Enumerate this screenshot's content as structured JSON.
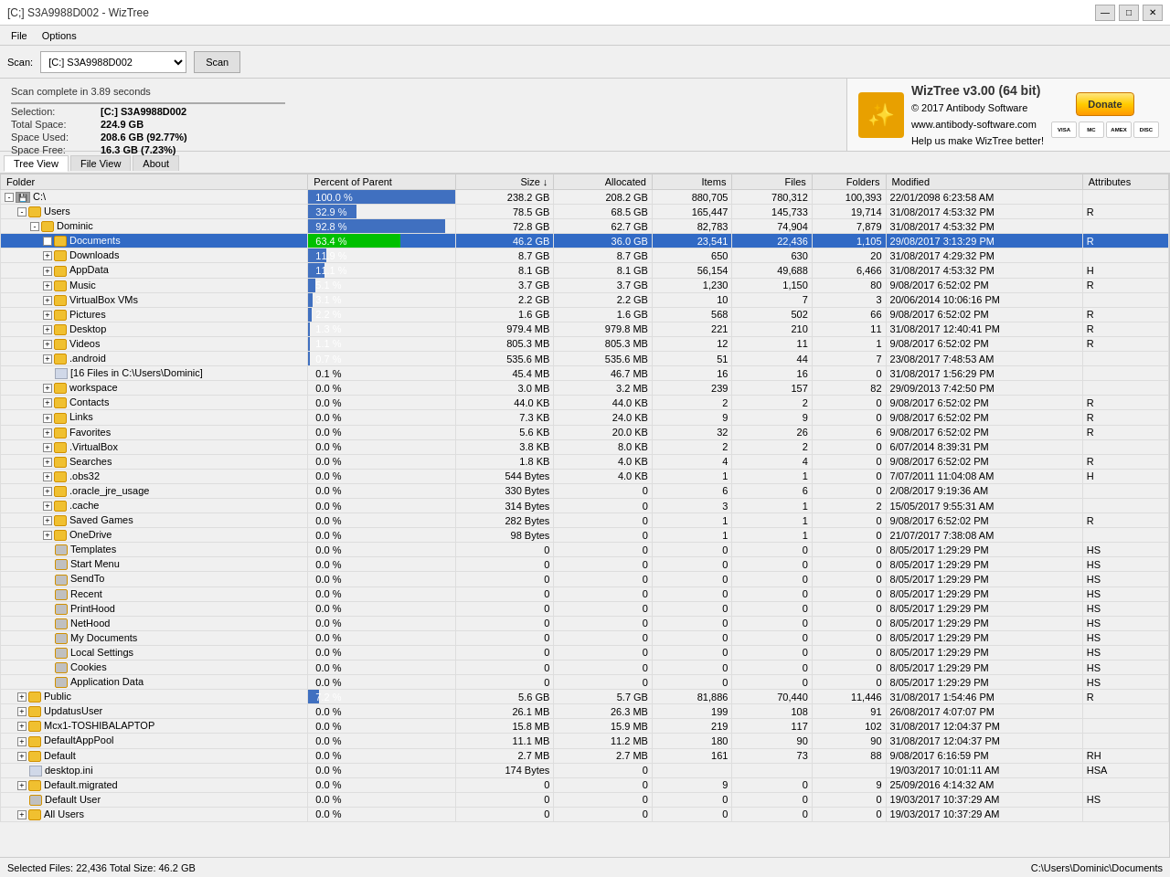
{
  "titleBar": {
    "title": "[C;] S3A9988D002  - WizTree"
  },
  "menuBar": {
    "items": [
      "File",
      "Options"
    ]
  },
  "toolbar": {
    "scanLabel": "Scan:",
    "driveValue": "[C:] S3A9988D002",
    "scanButton": "Scan"
  },
  "infoPanel": {
    "scanTime": "Scan complete in 3.89 seconds",
    "selectionLabel": "Selection:",
    "selectionValue": "[C:]  S3A9988D002",
    "totalSpaceLabel": "Total Space:",
    "totalSpaceValue": "224.9 GB",
    "spaceUsedLabel": "Space Used:",
    "spaceUsedValue": "208.6 GB  (92.77%)",
    "spaceFreeLabel": "Space Free:",
    "spaceFreeValue": "16.3 GB  (7.23%)"
  },
  "branding": {
    "title": "WizTree v3.00 (64 bit)",
    "line2": "© 2017 Antibody Software",
    "line3": "www.antibody-software.com",
    "donateBtn": "Donate",
    "helpText": "Help us make WizTree better!"
  },
  "tabs": {
    "treeView": "Tree View",
    "fileView": "File View",
    "about": "About"
  },
  "tableHeaders": {
    "folder": "Folder",
    "percentOfParent": "Percent of Parent",
    "size": "Size ↓",
    "allocated": "Allocated",
    "items": "Items",
    "files": "Files",
    "folders": "Folders",
    "modified": "Modified",
    "attributes": "Attributes"
  },
  "rows": [
    {
      "indent": 0,
      "toggle": "-",
      "icon": "drive",
      "name": "C:\\",
      "pct": 100.0,
      "pctBar": 100,
      "barGreen": false,
      "size": "238.2 GB",
      "alloc": "208.2 GB",
      "items": "880,705",
      "files": "780,312",
      "folders": "100,393",
      "modified": "22/01/2098 6:23:58 AM",
      "attr": ""
    },
    {
      "indent": 1,
      "toggle": "-",
      "icon": "folder",
      "name": "Users",
      "pct": 32.9,
      "pctBar": 33,
      "barGreen": false,
      "size": "78.5 GB",
      "alloc": "68.5 GB",
      "items": "165,447",
      "files": "145,733",
      "folders": "19,714",
      "modified": "31/08/2017 4:53:32 PM",
      "attr": "R"
    },
    {
      "indent": 2,
      "toggle": "-",
      "icon": "folder",
      "name": "Dominic",
      "pct": 92.8,
      "pctBar": 93,
      "barGreen": false,
      "size": "72.8 GB",
      "alloc": "62.7 GB",
      "items": "82,783",
      "files": "74,904",
      "folders": "7,879",
      "modified": "31/08/2017 4:53:32 PM",
      "attr": ""
    },
    {
      "indent": 3,
      "toggle": "+",
      "icon": "folder",
      "name": "Documents",
      "pct": 63.4,
      "pctBar": 63,
      "barGreen": true,
      "size": "46.2 GB",
      "alloc": "36.0 GB",
      "items": "23,541",
      "files": "22,436",
      "folders": "1,105",
      "modified": "29/08/2017 3:13:29 PM",
      "attr": "R",
      "selected": true
    },
    {
      "indent": 3,
      "toggle": "+",
      "icon": "folder",
      "name": "Downloads",
      "pct": 11.9,
      "pctBar": 12,
      "barGreen": false,
      "size": "8.7 GB",
      "alloc": "8.7 GB",
      "items": "650",
      "files": "630",
      "folders": "20",
      "modified": "31/08/2017 4:29:32 PM",
      "attr": ""
    },
    {
      "indent": 3,
      "toggle": "+",
      "icon": "folder",
      "name": "AppData",
      "pct": 11.1,
      "pctBar": 11,
      "barGreen": false,
      "size": "8.1 GB",
      "alloc": "8.1 GB",
      "items": "56,154",
      "files": "49,688",
      "folders": "6,466",
      "modified": "31/08/2017 4:53:32 PM",
      "attr": "H"
    },
    {
      "indent": 3,
      "toggle": "+",
      "icon": "folder",
      "name": "Music",
      "pct": 5.1,
      "pctBar": 5,
      "barGreen": false,
      "size": "3.7 GB",
      "alloc": "3.7 GB",
      "items": "1,230",
      "files": "1,150",
      "folders": "80",
      "modified": "9/08/2017 6:52:02 PM",
      "attr": "R"
    },
    {
      "indent": 3,
      "toggle": "+",
      "icon": "folder",
      "name": "VirtualBox VMs",
      "pct": 3.1,
      "pctBar": 3,
      "barGreen": false,
      "size": "2.2 GB",
      "alloc": "2.2 GB",
      "items": "10",
      "files": "7",
      "folders": "3",
      "modified": "20/06/2014 10:06:16 PM",
      "attr": ""
    },
    {
      "indent": 3,
      "toggle": "+",
      "icon": "folder",
      "name": "Pictures",
      "pct": 2.2,
      "pctBar": 2,
      "barGreen": false,
      "size": "1.6 GB",
      "alloc": "1.6 GB",
      "items": "568",
      "files": "502",
      "folders": "66",
      "modified": "9/08/2017 6:52:02 PM",
      "attr": "R"
    },
    {
      "indent": 3,
      "toggle": "+",
      "icon": "folder",
      "name": "Desktop",
      "pct": 1.3,
      "pctBar": 1,
      "barGreen": false,
      "size": "979.4 MB",
      "alloc": "979.8 MB",
      "items": "221",
      "files": "210",
      "folders": "11",
      "modified": "31/08/2017 12:40:41 PM",
      "attr": "R"
    },
    {
      "indent": 3,
      "toggle": "+",
      "icon": "folder",
      "name": "Videos",
      "pct": 1.1,
      "pctBar": 1,
      "barGreen": false,
      "size": "805.3 MB",
      "alloc": "805.3 MB",
      "items": "12",
      "files": "11",
      "folders": "1",
      "modified": "9/08/2017 6:52:02 PM",
      "attr": "R"
    },
    {
      "indent": 3,
      "toggle": "+",
      "icon": "folder",
      "name": ".android",
      "pct": 0.7,
      "pctBar": 1,
      "barGreen": false,
      "size": "535.6 MB",
      "alloc": "535.6 MB",
      "items": "51",
      "files": "44",
      "folders": "7",
      "modified": "23/08/2017 7:48:53 AM",
      "attr": ""
    },
    {
      "indent": 3,
      "toggle": " ",
      "icon": "file",
      "name": "[16 Files in C:\\Users\\Dominic]",
      "pct": 0.1,
      "pctBar": 0,
      "barGreen": false,
      "size": "45.4 MB",
      "alloc": "46.7 MB",
      "items": "16",
      "files": "16",
      "folders": "0",
      "modified": "31/08/2017 1:56:29 PM",
      "attr": ""
    },
    {
      "indent": 3,
      "toggle": "+",
      "icon": "folder",
      "name": "workspace",
      "pct": 0.0,
      "pctBar": 0,
      "barGreen": false,
      "size": "3.0 MB",
      "alloc": "3.2 MB",
      "items": "239",
      "files": "157",
      "folders": "82",
      "modified": "29/09/2013 7:42:50 PM",
      "attr": ""
    },
    {
      "indent": 3,
      "toggle": "+",
      "icon": "folder",
      "name": "Contacts",
      "pct": 0.0,
      "pctBar": 0,
      "barGreen": false,
      "size": "44.0 KB",
      "alloc": "44.0 KB",
      "items": "2",
      "files": "2",
      "folders": "0",
      "modified": "9/08/2017 6:52:02 PM",
      "attr": "R"
    },
    {
      "indent": 3,
      "toggle": "+",
      "icon": "folder",
      "name": "Links",
      "pct": 0.0,
      "pctBar": 0,
      "barGreen": false,
      "size": "7.3 KB",
      "alloc": "24.0 KB",
      "items": "9",
      "files": "9",
      "folders": "0",
      "modified": "9/08/2017 6:52:02 PM",
      "attr": "R"
    },
    {
      "indent": 3,
      "toggle": "+",
      "icon": "folder",
      "name": "Favorites",
      "pct": 0.0,
      "pctBar": 0,
      "barGreen": false,
      "size": "5.6 KB",
      "alloc": "20.0 KB",
      "items": "32",
      "files": "26",
      "folders": "6",
      "modified": "9/08/2017 6:52:02 PM",
      "attr": "R"
    },
    {
      "indent": 3,
      "toggle": "+",
      "icon": "folder",
      "name": ".VirtualBox",
      "pct": 0.0,
      "pctBar": 0,
      "barGreen": false,
      "size": "3.8 KB",
      "alloc": "8.0 KB",
      "items": "2",
      "files": "2",
      "folders": "0",
      "modified": "6/07/2014 8:39:31 PM",
      "attr": ""
    },
    {
      "indent": 3,
      "toggle": "+",
      "icon": "folder",
      "name": "Searches",
      "pct": 0.0,
      "pctBar": 0,
      "barGreen": false,
      "size": "1.8 KB",
      "alloc": "4.0 KB",
      "items": "4",
      "files": "4",
      "folders": "0",
      "modified": "9/08/2017 6:52:02 PM",
      "attr": "R"
    },
    {
      "indent": 3,
      "toggle": "+",
      "icon": "folder",
      "name": ".obs32",
      "pct": 0.0,
      "pctBar": 0,
      "barGreen": false,
      "size": "544 Bytes",
      "alloc": "4.0 KB",
      "items": "1",
      "files": "1",
      "folders": "0",
      "modified": "7/07/2011 11:04:08 AM",
      "attr": "H"
    },
    {
      "indent": 3,
      "toggle": "+",
      "icon": "folder",
      "name": ".oracle_jre_usage",
      "pct": 0.0,
      "pctBar": 0,
      "barGreen": false,
      "size": "330 Bytes",
      "alloc": "0",
      "items": "6",
      "files": "6",
      "folders": "0",
      "modified": "2/08/2017 9:19:36 AM",
      "attr": ""
    },
    {
      "indent": 3,
      "toggle": "+",
      "icon": "folder",
      "name": ".cache",
      "pct": 0.0,
      "pctBar": 0,
      "barGreen": false,
      "size": "314 Bytes",
      "alloc": "0",
      "items": "3",
      "files": "1",
      "folders": "2",
      "modified": "15/05/2017 9:55:31 AM",
      "attr": ""
    },
    {
      "indent": 3,
      "toggle": "+",
      "icon": "folder",
      "name": "Saved Games",
      "pct": 0.0,
      "pctBar": 0,
      "barGreen": false,
      "size": "282 Bytes",
      "alloc": "0",
      "items": "1",
      "files": "1",
      "folders": "0",
      "modified": "9/08/2017 6:52:02 PM",
      "attr": "R"
    },
    {
      "indent": 3,
      "toggle": "+",
      "icon": "folder",
      "name": "OneDrive",
      "pct": 0.0,
      "pctBar": 0,
      "barGreen": false,
      "size": "98 Bytes",
      "alloc": "0",
      "items": "1",
      "files": "1",
      "folders": "0",
      "modified": "21/07/2017 7:38:08 AM",
      "attr": ""
    },
    {
      "indent": 3,
      "toggle": " ",
      "icon": "gear",
      "name": "Templates",
      "pct": 0.0,
      "pctBar": 0,
      "barGreen": false,
      "size": "0",
      "alloc": "0",
      "items": "0",
      "files": "0",
      "folders": "0",
      "modified": "8/05/2017 1:29:29 PM",
      "attr": "HS"
    },
    {
      "indent": 3,
      "toggle": " ",
      "icon": "gear",
      "name": "Start Menu",
      "pct": 0.0,
      "pctBar": 0,
      "barGreen": false,
      "size": "0",
      "alloc": "0",
      "items": "0",
      "files": "0",
      "folders": "0",
      "modified": "8/05/2017 1:29:29 PM",
      "attr": "HS"
    },
    {
      "indent": 3,
      "toggle": " ",
      "icon": "gear",
      "name": "SendTo",
      "pct": 0.0,
      "pctBar": 0,
      "barGreen": false,
      "size": "0",
      "alloc": "0",
      "items": "0",
      "files": "0",
      "folders": "0",
      "modified": "8/05/2017 1:29:29 PM",
      "attr": "HS"
    },
    {
      "indent": 3,
      "toggle": " ",
      "icon": "gear",
      "name": "Recent",
      "pct": 0.0,
      "pctBar": 0,
      "barGreen": false,
      "size": "0",
      "alloc": "0",
      "items": "0",
      "files": "0",
      "folders": "0",
      "modified": "8/05/2017 1:29:29 PM",
      "attr": "HS"
    },
    {
      "indent": 3,
      "toggle": " ",
      "icon": "gear",
      "name": "PrintHood",
      "pct": 0.0,
      "pctBar": 0,
      "barGreen": false,
      "size": "0",
      "alloc": "0",
      "items": "0",
      "files": "0",
      "folders": "0",
      "modified": "8/05/2017 1:29:29 PM",
      "attr": "HS"
    },
    {
      "indent": 3,
      "toggle": " ",
      "icon": "gear",
      "name": "NetHood",
      "pct": 0.0,
      "pctBar": 0,
      "barGreen": false,
      "size": "0",
      "alloc": "0",
      "items": "0",
      "files": "0",
      "folders": "0",
      "modified": "8/05/2017 1:29:29 PM",
      "attr": "HS"
    },
    {
      "indent": 3,
      "toggle": " ",
      "icon": "gear",
      "name": "My Documents",
      "pct": 0.0,
      "pctBar": 0,
      "barGreen": false,
      "size": "0",
      "alloc": "0",
      "items": "0",
      "files": "0",
      "folders": "0",
      "modified": "8/05/2017 1:29:29 PM",
      "attr": "HS"
    },
    {
      "indent": 3,
      "toggle": " ",
      "icon": "gear",
      "name": "Local Settings",
      "pct": 0.0,
      "pctBar": 0,
      "barGreen": false,
      "size": "0",
      "alloc": "0",
      "items": "0",
      "files": "0",
      "folders": "0",
      "modified": "8/05/2017 1:29:29 PM",
      "attr": "HS"
    },
    {
      "indent": 3,
      "toggle": " ",
      "icon": "gear",
      "name": "Cookies",
      "pct": 0.0,
      "pctBar": 0,
      "barGreen": false,
      "size": "0",
      "alloc": "0",
      "items": "0",
      "files": "0",
      "folders": "0",
      "modified": "8/05/2017 1:29:29 PM",
      "attr": "HS"
    },
    {
      "indent": 3,
      "toggle": " ",
      "icon": "gear",
      "name": "Application Data",
      "pct": 0.0,
      "pctBar": 0,
      "barGreen": false,
      "size": "0",
      "alloc": "0",
      "items": "0",
      "files": "0",
      "folders": "0",
      "modified": "8/05/2017 1:29:29 PM",
      "attr": "HS"
    },
    {
      "indent": 1,
      "toggle": "+",
      "icon": "folder",
      "name": "Public",
      "pct": 7.2,
      "pctBar": 7,
      "barGreen": false,
      "size": "5.6 GB",
      "alloc": "5.7 GB",
      "items": "81,886",
      "files": "70,440",
      "folders": "11,446",
      "modified": "31/08/2017 1:54:46 PM",
      "attr": "R"
    },
    {
      "indent": 1,
      "toggle": "+",
      "icon": "folder",
      "name": "UpdatusUser",
      "pct": 0.0,
      "pctBar": 0,
      "barGreen": false,
      "size": "26.1 MB",
      "alloc": "26.3 MB",
      "items": "199",
      "files": "108",
      "folders": "91",
      "modified": "26/08/2017 4:07:07 PM",
      "attr": ""
    },
    {
      "indent": 1,
      "toggle": "+",
      "icon": "folder",
      "name": "Mcx1-TOSHIBALAPTOP",
      "pct": 0.0,
      "pctBar": 0,
      "barGreen": false,
      "size": "15.8 MB",
      "alloc": "15.9 MB",
      "items": "219",
      "files": "117",
      "folders": "102",
      "modified": "31/08/2017 12:04:37 PM",
      "attr": ""
    },
    {
      "indent": 1,
      "toggle": "+",
      "icon": "folder",
      "name": "DefaultAppPool",
      "pct": 0.0,
      "pctBar": 0,
      "barGreen": false,
      "size": "11.1 MB",
      "alloc": "11.2 MB",
      "items": "180",
      "files": "90",
      "folders": "90",
      "modified": "31/08/2017 12:04:37 PM",
      "attr": ""
    },
    {
      "indent": 1,
      "toggle": "+",
      "icon": "folder",
      "name": "Default",
      "pct": 0.0,
      "pctBar": 0,
      "barGreen": false,
      "size": "2.7 MB",
      "alloc": "2.7 MB",
      "items": "161",
      "files": "73",
      "folders": "88",
      "modified": "9/08/2017 6:16:59 PM",
      "attr": "RH"
    },
    {
      "indent": 1,
      "toggle": " ",
      "icon": "file",
      "name": "desktop.ini",
      "pct": 0.0,
      "pctBar": 0,
      "barGreen": false,
      "size": "174 Bytes",
      "alloc": "0",
      "items": "",
      "files": "",
      "folders": "",
      "modified": "19/03/2017 10:01:11 AM",
      "attr": "HSA"
    },
    {
      "indent": 1,
      "toggle": "+",
      "icon": "folder",
      "name": "Default.migrated",
      "pct": 0.0,
      "pctBar": 0,
      "barGreen": false,
      "size": "0",
      "alloc": "0",
      "items": "9",
      "files": "0",
      "folders": "9",
      "modified": "25/09/2016 4:14:32 AM",
      "attr": ""
    },
    {
      "indent": 1,
      "toggle": " ",
      "icon": "gear",
      "name": "Default User",
      "pct": 0.0,
      "pctBar": 0,
      "barGreen": false,
      "size": "0",
      "alloc": "0",
      "items": "0",
      "files": "0",
      "folders": "0",
      "modified": "19/03/2017 10:37:29 AM",
      "attr": "HS"
    },
    {
      "indent": 1,
      "toggle": "+",
      "icon": "folder",
      "name": "All Users",
      "pct": 0.0,
      "pctBar": 0,
      "barGreen": false,
      "size": "0",
      "alloc": "0",
      "items": "0",
      "files": "0",
      "folders": "0",
      "modified": "19/03/2017 10:37:29 AM",
      "attr": ""
    }
  ],
  "statusBar": {
    "selectedFiles": "Selected Files: 22,436 Total Size: 46.2 GB",
    "path": "C:\\Users\\Dominic\\Documents"
  }
}
